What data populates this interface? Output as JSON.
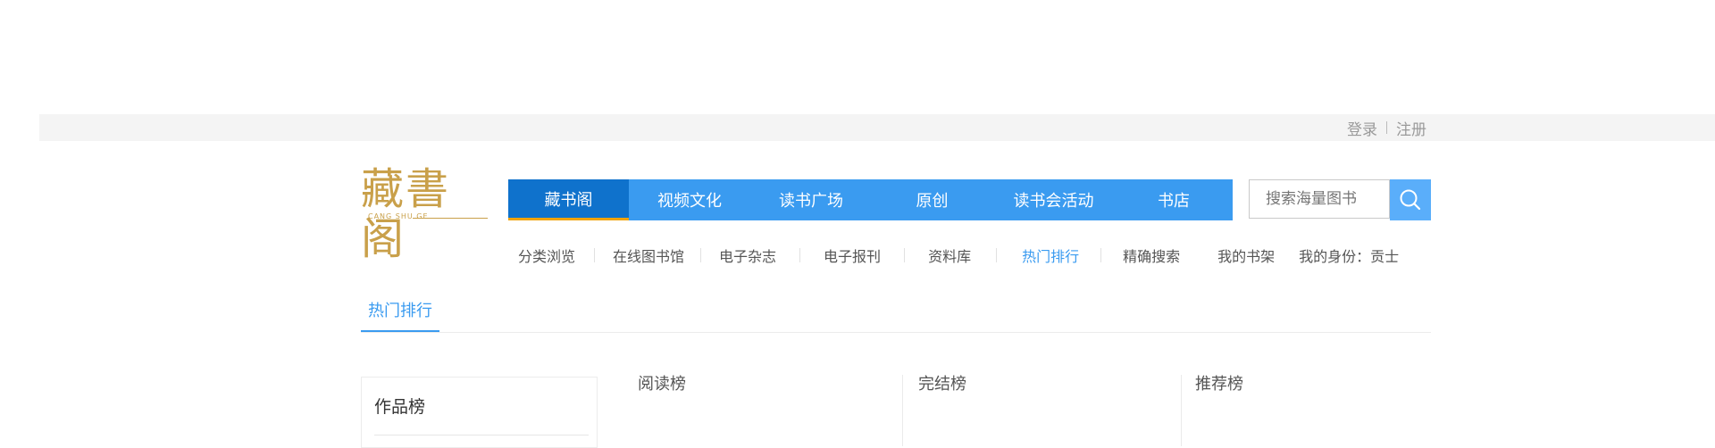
{
  "topbar": {
    "login": "登录",
    "register": "注册"
  },
  "logo": {
    "name": "藏書阁",
    "sub": "CANG SHU GE"
  },
  "mainnav": [
    {
      "label": "藏书阁",
      "active": true
    },
    {
      "label": "视频文化",
      "active": false
    },
    {
      "label": "读书广场",
      "active": false
    },
    {
      "label": "原创",
      "active": false
    },
    {
      "label": "读书会活动",
      "active": false
    },
    {
      "label": "书店",
      "active": false
    }
  ],
  "search": {
    "placeholder": "搜索海量图书",
    "icon": "search-icon"
  },
  "subnav": [
    {
      "label": "分类浏览",
      "active": false
    },
    {
      "label": "在线图书馆",
      "active": false
    },
    {
      "label": "电子杂志",
      "active": false
    },
    {
      "label": "电子报刊",
      "active": false
    },
    {
      "label": "资料库",
      "active": false
    },
    {
      "label": "热门排行",
      "active": true
    },
    {
      "label": "精确搜索",
      "active": false
    },
    {
      "label": "我的书架",
      "active": false
    },
    {
      "label": "我的身份：贡士",
      "active": false
    }
  ],
  "page_tab": {
    "label": "热门排行"
  },
  "sidebar": {
    "title": "作品榜"
  },
  "rank_columns": [
    "阅读榜",
    "完结榜",
    "推荐榜"
  ],
  "colors": {
    "accent": "#3a9bf0",
    "nav_active": "#0f72cc",
    "gold": "#c9a04a"
  }
}
